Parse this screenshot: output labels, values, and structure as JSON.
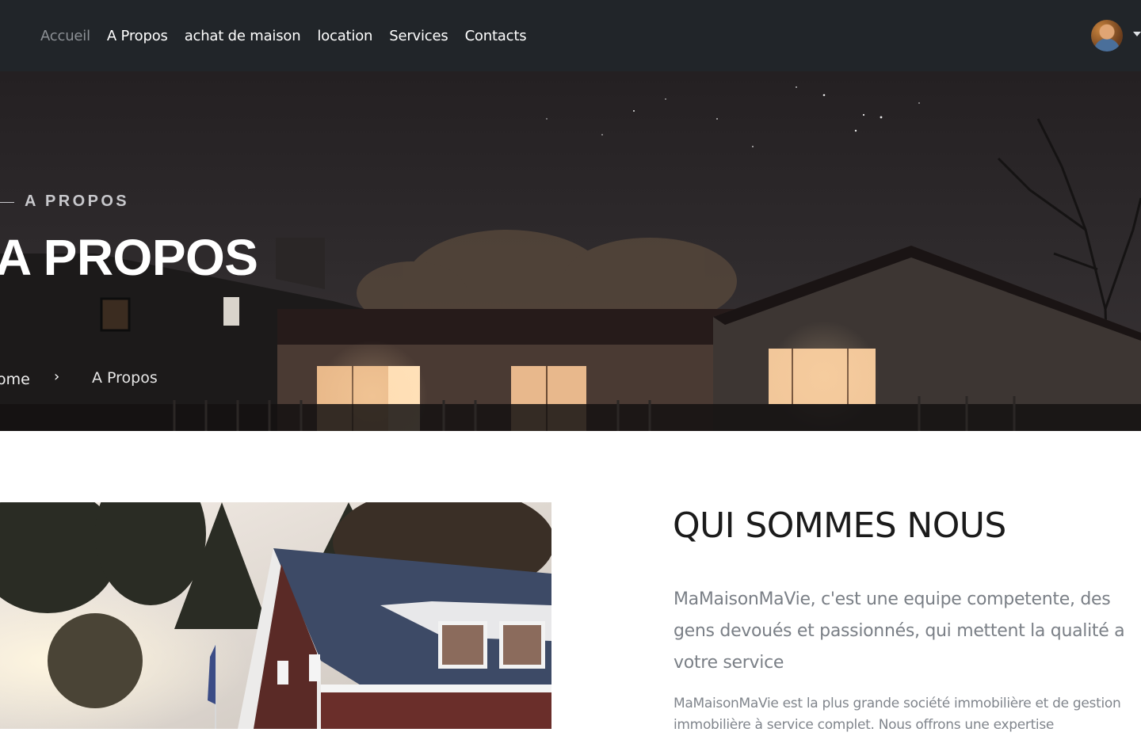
{
  "navbar": {
    "links": [
      {
        "label": "Accueil",
        "active": true
      },
      {
        "label": "A Propos",
        "active": false
      },
      {
        "label": "achat de maison",
        "active": false
      },
      {
        "label": "location",
        "active": false
      },
      {
        "label": "Services",
        "active": false
      },
      {
        "label": "Contacts",
        "active": false
      }
    ],
    "avatar_icon": "user-avatar-icon",
    "dropdown_icon": "caret-down-icon",
    "background": "#212529"
  },
  "hero": {
    "kicker": "A PROPOS",
    "title": "A PROPOS",
    "breadcrumb": {
      "home": "ome",
      "separator": "›",
      "current": "A Propos"
    }
  },
  "about": {
    "title": "QUI SOMMES NOUS",
    "lead": "MaMaisonMaVie, c'est une equipe competente, des gens devoués et passionnés, qui mettent la qualité a votre service",
    "body": "MaMaisonMaVie est la plus grande société immobilière et de gestion immobilière à service complet. Nous offrons une expertise"
  }
}
